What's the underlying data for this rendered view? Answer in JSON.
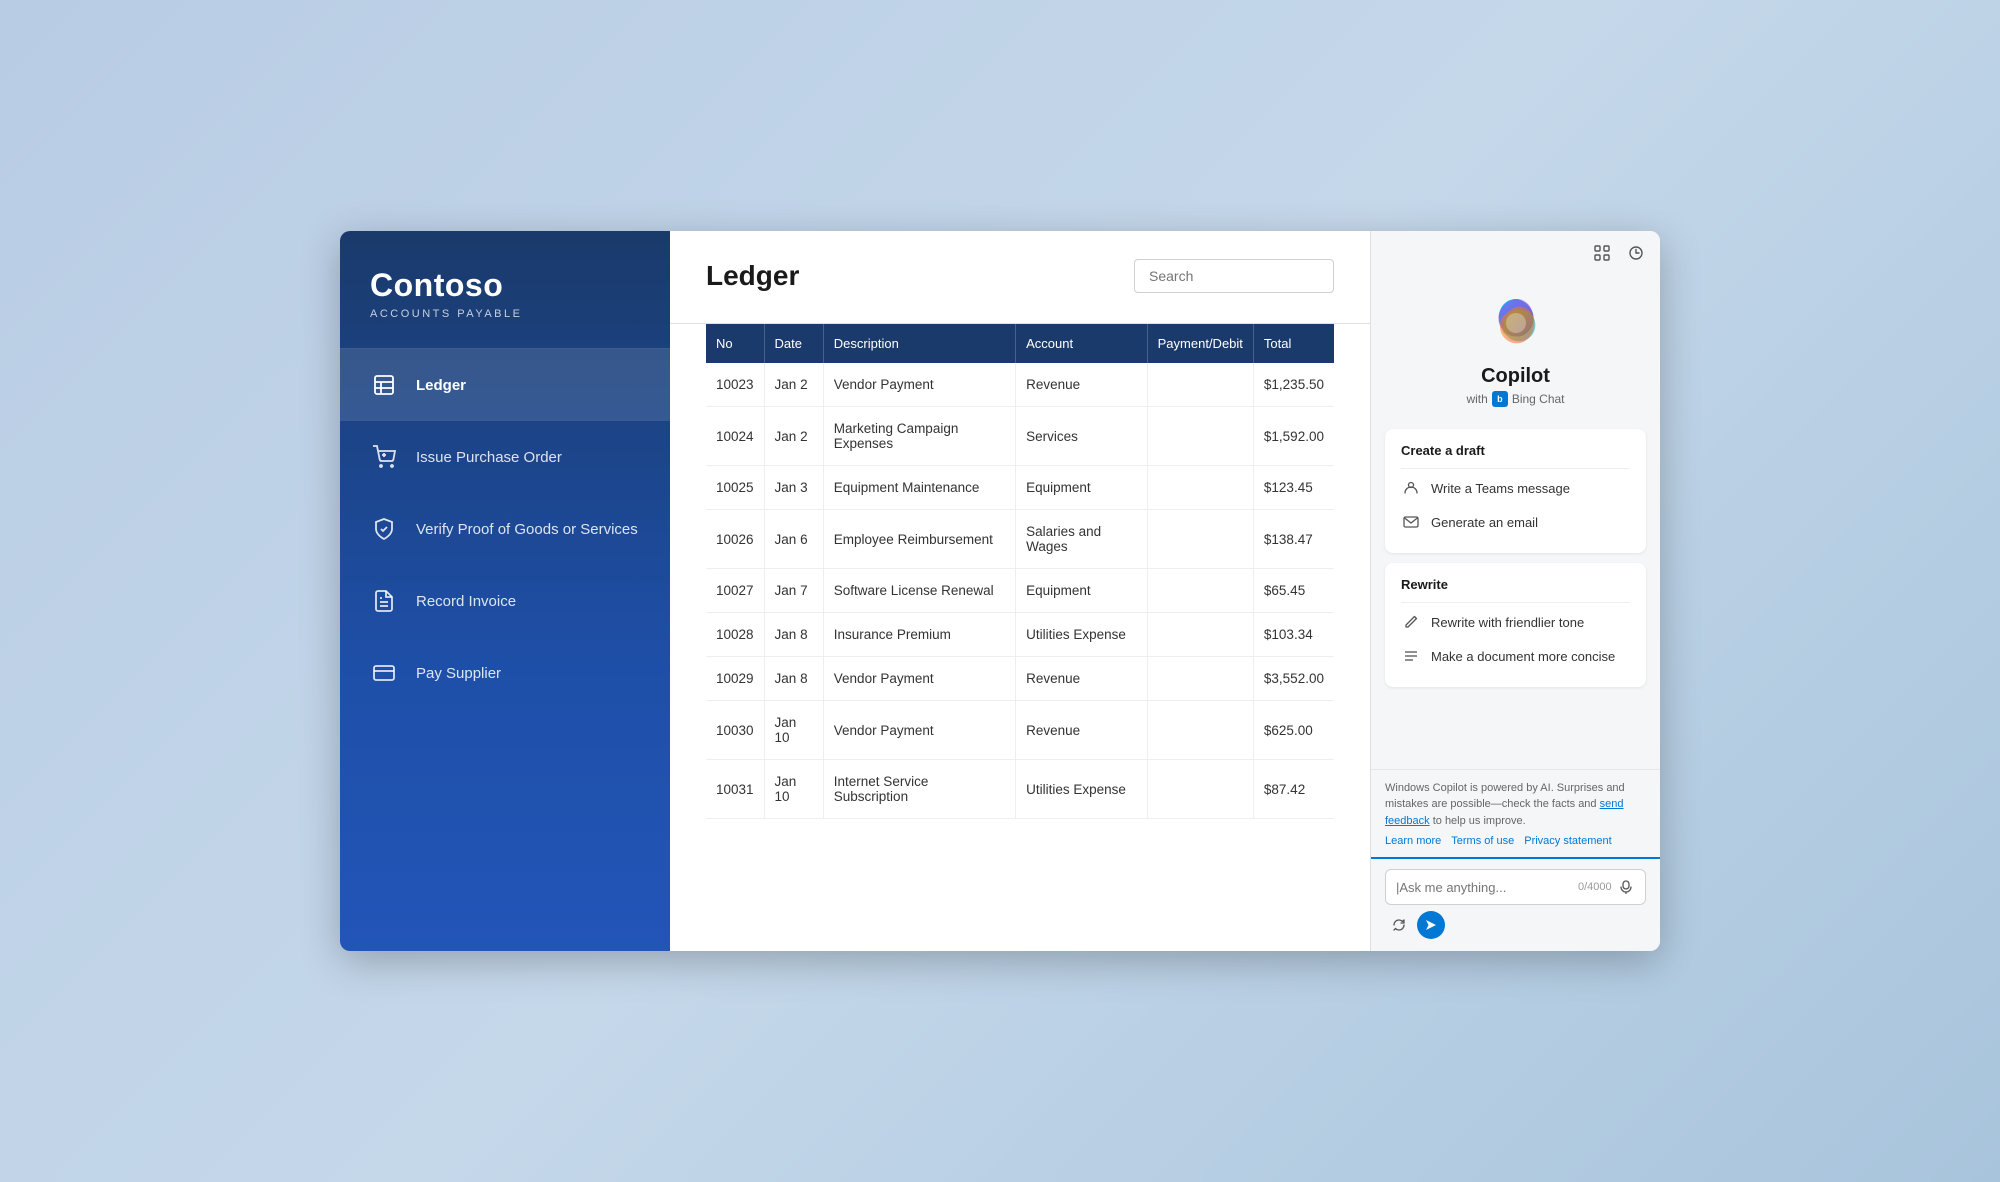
{
  "app": {
    "title": "Contoso Accounts Payable"
  },
  "sidebar": {
    "logo": "Contoso",
    "subtitle": "ACCOUNTS PAYABLE",
    "nav_items": [
      {
        "id": "ledger",
        "label": "Ledger",
        "active": true,
        "icon": "ledger"
      },
      {
        "id": "purchase-order",
        "label": "Issue Purchase Order",
        "active": false,
        "icon": "cart"
      },
      {
        "id": "verify-proof",
        "label": "Verify Proof of Goods or Services",
        "active": false,
        "icon": "verify"
      },
      {
        "id": "record-invoice",
        "label": "Record Invoice",
        "active": false,
        "icon": "invoice"
      },
      {
        "id": "pay-supplier",
        "label": "Pay Supplier",
        "active": false,
        "icon": "pay"
      }
    ]
  },
  "main": {
    "title": "Ledger",
    "search_placeholder": "Search",
    "table": {
      "columns": [
        "No",
        "Date",
        "Description",
        "Account",
        "Payment/Debit",
        "Total"
      ],
      "rows": [
        {
          "no": "10023",
          "date": "Jan 2",
          "description": "Vendor Payment",
          "account": "Revenue",
          "payment_debit": "",
          "total": "$1,235.50"
        },
        {
          "no": "10024",
          "date": "Jan 2",
          "description": "Marketing Campaign Expenses",
          "account": "Services",
          "payment_debit": "",
          "total": "$1,592.00"
        },
        {
          "no": "10025",
          "date": "Jan 3",
          "description": "Equipment Maintenance",
          "account": "Equipment",
          "payment_debit": "",
          "total": "$123.45"
        },
        {
          "no": "10026",
          "date": "Jan 6",
          "description": "Employee Reimbursement",
          "account": "Salaries and Wages",
          "payment_debit": "",
          "total": "$138.47"
        },
        {
          "no": "10027",
          "date": "Jan 7",
          "description": "Software License Renewal",
          "account": "Equipment",
          "payment_debit": "",
          "total": "$65.45"
        },
        {
          "no": "10028",
          "date": "Jan 8",
          "description": "Insurance Premium",
          "account": "Utilities Expense",
          "payment_debit": "",
          "total": "$103.34"
        },
        {
          "no": "10029",
          "date": "Jan 8",
          "description": "Vendor Payment",
          "account": "Revenue",
          "payment_debit": "",
          "total": "$3,552.00"
        },
        {
          "no": "10030",
          "date": "Jan 10",
          "description": "Vendor Payment",
          "account": "Revenue",
          "payment_debit": "",
          "total": "$625.00"
        },
        {
          "no": "10031",
          "date": "Jan 10",
          "description": "Internet Service Subscription",
          "account": "Utilities Expense",
          "payment_debit": "",
          "total": "$87.42"
        }
      ]
    }
  },
  "copilot": {
    "title": "Copilot",
    "subtitle": "with",
    "bing_chat_label": "Bing Chat",
    "create_draft_section": {
      "title": "Create a draft",
      "items": [
        {
          "id": "teams-message",
          "label": "Write a Teams message",
          "icon": "teams"
        },
        {
          "id": "generate-email",
          "label": "Generate an email",
          "icon": "email"
        }
      ]
    },
    "rewrite_section": {
      "title": "Rewrite",
      "items": [
        {
          "id": "friendlier-tone",
          "label": "Rewrite with friendlier tone",
          "icon": "pencil"
        },
        {
          "id": "more-concise",
          "label": "Make a document more concise",
          "icon": "lines"
        }
      ]
    },
    "footer": {
      "text": "Windows Copilot is powered by AI. Surprises and mistakes are possible—check the facts and",
      "feedback_link": "send feedback",
      "after_text": "to help us improve.",
      "learn_more": "Learn more",
      "terms": "Terms of use",
      "privacy": "Privacy statement"
    },
    "input": {
      "placeholder": "|Ask me anything...",
      "char_count": "0/4000"
    }
  }
}
